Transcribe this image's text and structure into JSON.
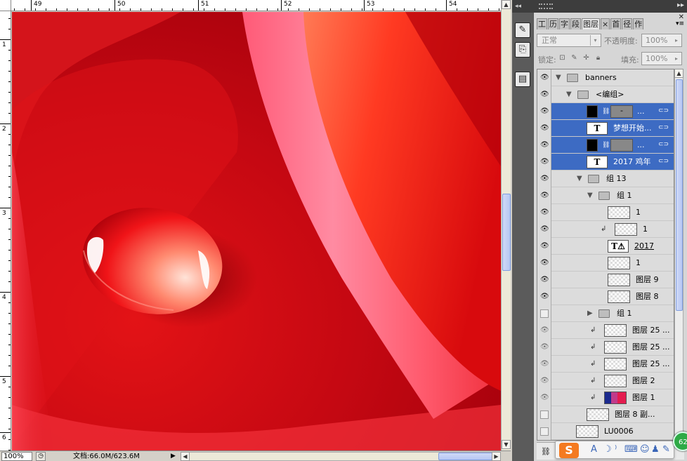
{
  "ruler": {
    "top_labels": [
      "49",
      "50",
      "51",
      "52",
      "53",
      "54"
    ],
    "left_labels": [
      "1",
      "2",
      "3",
      "4",
      "5",
      "6"
    ]
  },
  "status": {
    "zoom": "100%",
    "doc_info": "文档:66.0M/623.6M",
    "arrow": "▶"
  },
  "panel": {
    "tabs": [
      "工",
      "历",
      "字",
      "段",
      "图层",
      "×",
      "首",
      "径",
      "作"
    ],
    "active_tab": "图层",
    "blend_mode": "正常",
    "opacity_label": "不透明度:",
    "opacity_value": "100%",
    "lock_label": "锁定:",
    "fill_label": "填充:",
    "fill_value": "100%"
  },
  "layers": [
    {
      "name": "banners",
      "type": "group",
      "expanded": true,
      "indent": 0,
      "visible": true,
      "selected": false
    },
    {
      "name": "<编组>",
      "type": "group",
      "expanded": true,
      "indent": 1,
      "visible": true,
      "selected": false
    },
    {
      "name": "...",
      "type": "mask",
      "indent": 2,
      "visible": true,
      "selected": true,
      "linked": true,
      "thumb": "black",
      "mask": "grey",
      "mask_glyph": "-"
    },
    {
      "name": "梦想开始...",
      "type": "text",
      "indent": 2,
      "visible": true,
      "selected": true,
      "linked": true
    },
    {
      "name": "...",
      "type": "mask",
      "indent": 2,
      "visible": true,
      "selected": true,
      "linked": true,
      "thumb": "black",
      "mask": "grey",
      "mask_glyph": ""
    },
    {
      "name": "2017 鸡年",
      "type": "text",
      "indent": 2,
      "visible": true,
      "selected": true,
      "linked": true
    },
    {
      "name": "组 13",
      "type": "group",
      "expanded": true,
      "indent": 2,
      "visible": true,
      "selected": false
    },
    {
      "name": "组 1",
      "type": "group",
      "expanded": true,
      "indent": 3,
      "visible": true,
      "selected": false
    },
    {
      "name": "1",
      "type": "pixel",
      "indent": 4,
      "visible": true,
      "selected": false
    },
    {
      "name": "1",
      "type": "pixel",
      "indent": 4,
      "visible": true,
      "selected": false,
      "clipped": true
    },
    {
      "name": "2017",
      "type": "text-warn",
      "indent": 4,
      "visible": true,
      "selected": false
    },
    {
      "name": "1",
      "type": "pixel",
      "indent": 4,
      "visible": true,
      "selected": false
    },
    {
      "name": "图层 9",
      "type": "pixel",
      "indent": 4,
      "visible": true,
      "selected": false
    },
    {
      "name": "图层 8",
      "type": "pixel",
      "indent": 4,
      "visible": true,
      "selected": false
    },
    {
      "name": "组 1",
      "type": "group",
      "expanded": false,
      "indent": 3,
      "visible": false,
      "selected": false
    },
    {
      "name": "图层 25 ...",
      "type": "pixel",
      "indent": 3,
      "visible": true,
      "dim": true,
      "selected": false,
      "clipped": true
    },
    {
      "name": "图层 25 ...",
      "type": "pixel",
      "indent": 3,
      "visible": true,
      "dim": true,
      "selected": false,
      "clipped": true
    },
    {
      "name": "图层 25 ...",
      "type": "pixel",
      "indent": 3,
      "visible": true,
      "dim": true,
      "selected": false,
      "clipped": true
    },
    {
      "name": "图层 2",
      "type": "pixel",
      "indent": 3,
      "visible": true,
      "dim": true,
      "selected": false,
      "clipped": true
    },
    {
      "name": "图层 1",
      "type": "image",
      "indent": 3,
      "visible": true,
      "dim": true,
      "selected": false,
      "clipped": true
    },
    {
      "name": "图层 8 副...",
      "type": "pixel",
      "indent": 2,
      "visible": false,
      "selected": false
    },
    {
      "name": "LU0006",
      "type": "pixel",
      "indent": 1,
      "visible": false,
      "selected": false
    }
  ],
  "ime": {
    "logo": "S"
  },
  "badge": {
    "value": "62"
  },
  "colors": {
    "selected": "#3d6bc3",
    "canvas_red": "#d0101a"
  }
}
